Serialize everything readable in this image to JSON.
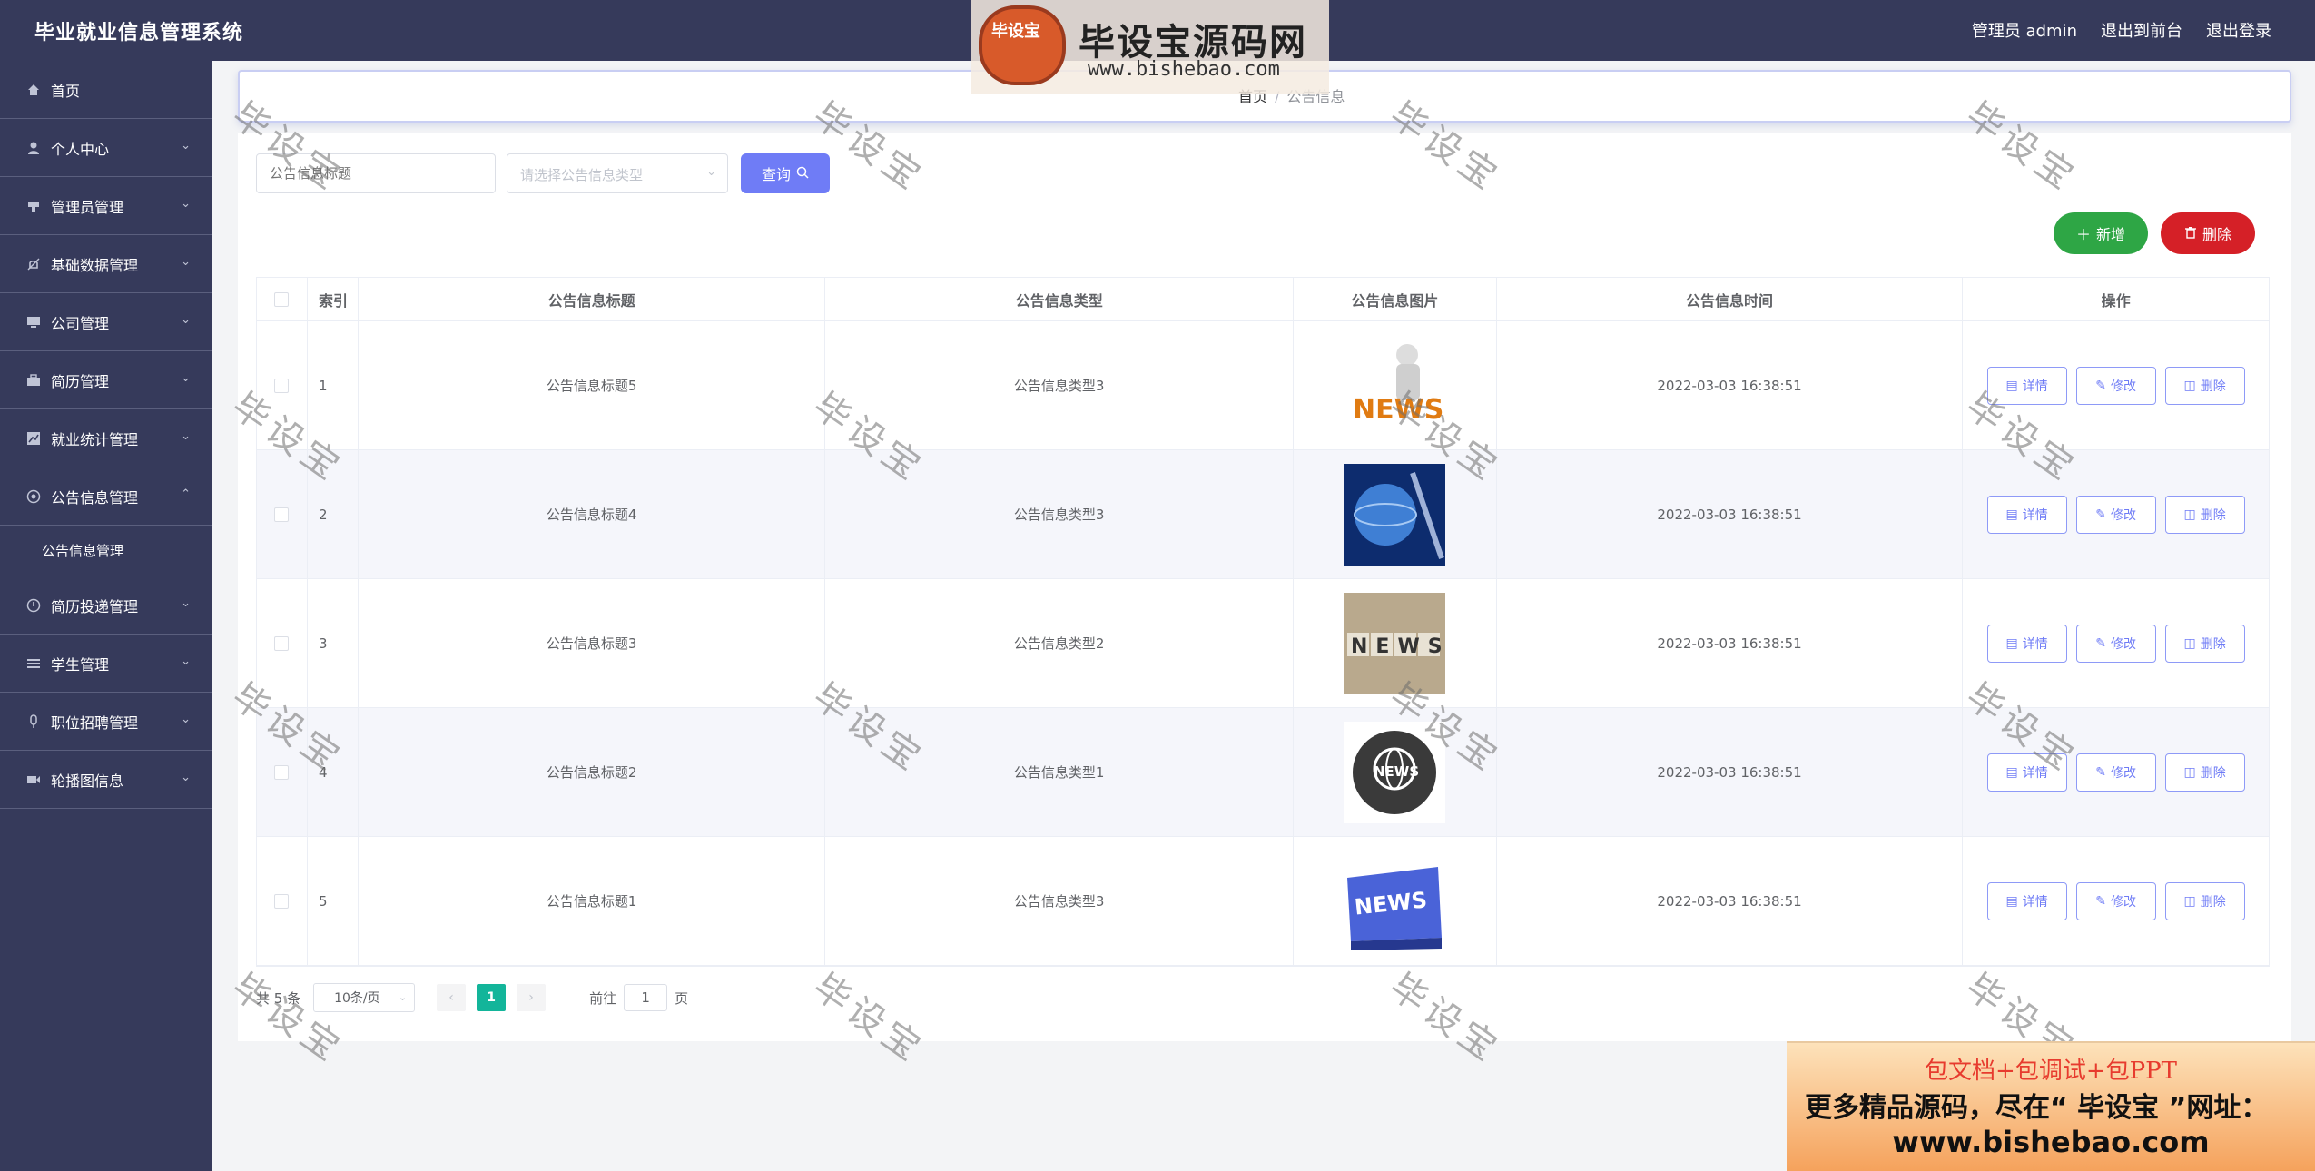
{
  "app": {
    "title": "毕业就业信息管理系统"
  },
  "header": {
    "user_label": "管理员 admin",
    "front_link": "退出到前台",
    "logout_link": "退出登录"
  },
  "sidebar": {
    "items": [
      {
        "label": "首页",
        "icon": "home-icon"
      },
      {
        "label": "个人中心",
        "icon": "user-icon"
      },
      {
        "label": "管理员管理",
        "icon": "admin-icon"
      },
      {
        "label": "基础数据管理",
        "icon": "bell-icon"
      },
      {
        "label": "公司管理",
        "icon": "monitor-icon"
      },
      {
        "label": "简历管理",
        "icon": "briefcase-icon"
      },
      {
        "label": "就业统计管理",
        "icon": "chart-icon"
      },
      {
        "label": "公告信息管理",
        "icon": "notice-icon",
        "expanded": true
      },
      {
        "label": "简历投递管理",
        "icon": "send-icon"
      },
      {
        "label": "学生管理",
        "icon": "list-icon"
      },
      {
        "label": "职位招聘管理",
        "icon": "pin-icon"
      },
      {
        "label": "轮播图信息",
        "icon": "carousel-icon"
      }
    ],
    "sub_item": "公告信息管理"
  },
  "breadcrumb": {
    "home": "首页",
    "separator": "/",
    "current": "公告信息"
  },
  "search": {
    "title_placeholder": "公告信息标题",
    "type_placeholder": "请选择公告信息类型",
    "query_label": "查询"
  },
  "actions": {
    "add_label": "新增",
    "delete_label": "删除"
  },
  "table": {
    "headers": {
      "index": "索引",
      "title": "公告信息标题",
      "type": "公告信息类型",
      "image": "公告信息图片",
      "time": "公告信息时间",
      "ops": "操作"
    },
    "rows": [
      {
        "index": "1",
        "title": "公告信息标题5",
        "type": "公告信息类型3",
        "time": "2022-03-03 16:38:51"
      },
      {
        "index": "2",
        "title": "公告信息标题4",
        "type": "公告信息类型3",
        "time": "2022-03-03 16:38:51"
      },
      {
        "index": "3",
        "title": "公告信息标题3",
        "type": "公告信息类型2",
        "time": "2022-03-03 16:38:51"
      },
      {
        "index": "4",
        "title": "公告信息标题2",
        "type": "公告信息类型1",
        "time": "2022-03-03 16:38:51"
      },
      {
        "index": "5",
        "title": "公告信息标题1",
        "type": "公告信息类型3",
        "time": "2022-03-03 16:38:51"
      }
    ],
    "op_labels": {
      "detail": "详情",
      "edit": "修改",
      "delete": "删除"
    },
    "thumb_text": [
      "NEWS",
      "",
      "NEWS",
      "NEWS",
      "NEWS"
    ]
  },
  "pagination": {
    "total": "共 5 条",
    "page_size": "10条/页",
    "current_page": "1",
    "goto_prefix": "前往",
    "goto_value": "1",
    "goto_suffix": "页"
  },
  "watermark": {
    "text": "毕设宝",
    "logo_badge": "毕设宝",
    "logo_text": "毕设宝源码网",
    "logo_url": "www.bishebao.com"
  },
  "promo": {
    "line1": "包文档+包调试+包PPT",
    "line2": "更多精品源码，尽在“ 毕设宝 ”网址：",
    "line3": "www.bishebao.com"
  },
  "colors": {
    "sidebar": "#363a5b",
    "primary": "#6f7cf6",
    "success": "#2ea645",
    "danger": "#d52027",
    "pager_active": "#13b59a"
  }
}
